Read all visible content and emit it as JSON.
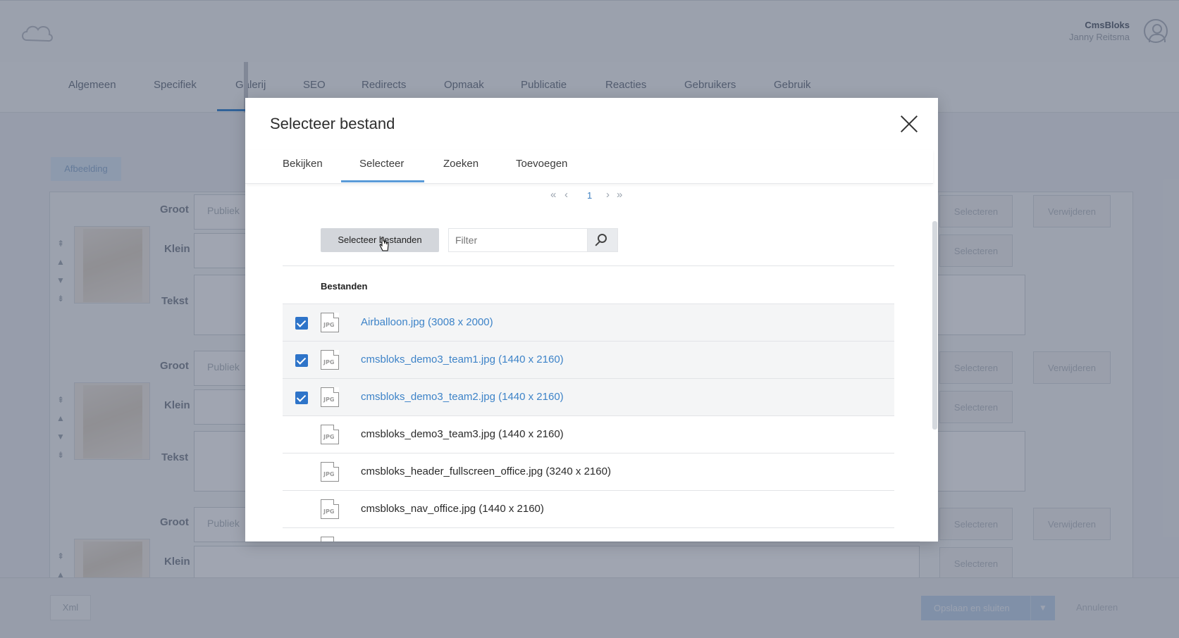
{
  "app": {
    "user_company": "CmsBloks",
    "user_name": "Janny Reitsma"
  },
  "nav_tabs": [
    "Algemeen",
    "Specifiek",
    "Galerij",
    "SEO",
    "Redirects",
    "Opmaak",
    "Publicatie",
    "Reacties",
    "Gebruikers",
    "Gebruik"
  ],
  "gallery": {
    "add_button": "Afbeelding",
    "labels": {
      "groot": "Groot",
      "klein": "Klein",
      "tekst": "Tekst"
    },
    "placeholder": "Publiek",
    "select_button": "Selecteren",
    "remove_button": "Verwijderen"
  },
  "footer": {
    "xml_button": "Xml",
    "save_button": "Opslaan en sluiten",
    "cancel_button": "Annuleren"
  },
  "modal": {
    "title": "Selecteer bestand",
    "tabs": [
      "Bekijken",
      "Selecteer",
      "Zoeken",
      "Toevoegen"
    ],
    "active_tab": "Selecteer",
    "pager": {
      "first": "«",
      "prev": "‹",
      "current": "1",
      "next": "›",
      "last": "»"
    },
    "select_files_button": "Selecteer bestanden",
    "filter_placeholder": "Filter",
    "column_header": "Bestanden",
    "file_icon_label": "JPG",
    "files": [
      {
        "name": "Airballoon.jpg (3008 x 2000)",
        "checked": true
      },
      {
        "name": "cmsbloks_demo3_team1.jpg (1440 x 2160)",
        "checked": true
      },
      {
        "name": "cmsbloks_demo3_team2.jpg (1440 x 2160)",
        "checked": true
      },
      {
        "name": "cmsbloks_demo3_team3.jpg (1440 x 2160)",
        "checked": false
      },
      {
        "name": "cmsbloks_header_fullscreen_office.jpg (3240 x 2160)",
        "checked": false
      },
      {
        "name": "cmsbloks_nav_office.jpg (1440 x 2160)",
        "checked": false
      }
    ]
  },
  "colors": {
    "accent": "#2e74c9",
    "link": "#3d83c8",
    "tab_underline": "#5a9bd8"
  }
}
